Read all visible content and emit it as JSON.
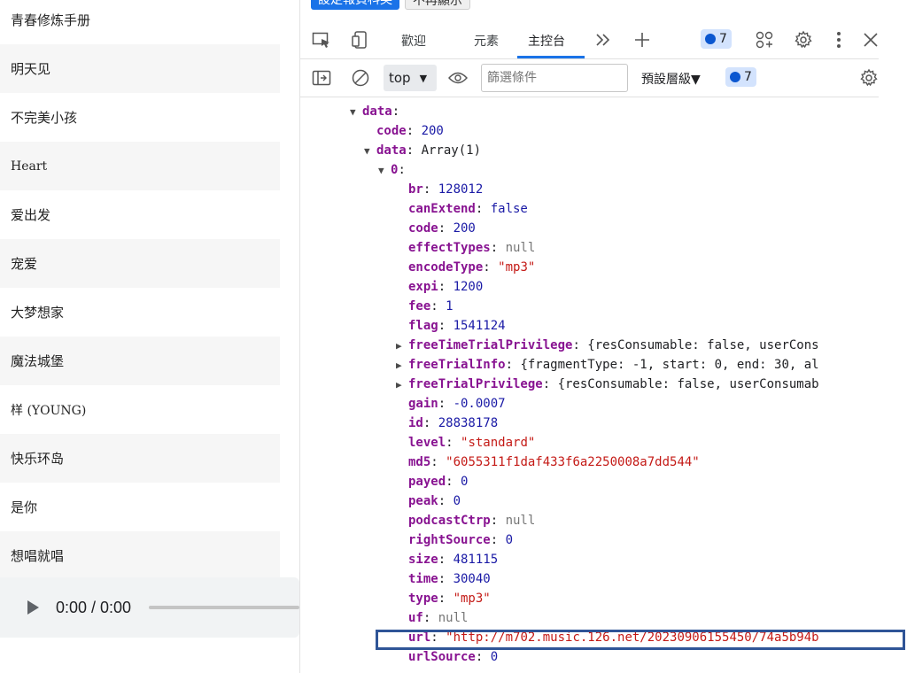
{
  "songs": [
    "青春修炼手册",
    "明天见",
    "不完美小孩",
    "Heart",
    "爱出发",
    "宠爱",
    "大梦想家",
    "魔法城堡",
    "样 (YOUNG)",
    "快乐环岛",
    "是你",
    "想唱就唱"
  ],
  "player": {
    "time": "0:00 / 0:00",
    "progress": 0
  },
  "page_buttons": {
    "primary": "設定報頁科英",
    "secondary": "不再顯示"
  },
  "devtools": {
    "tabs": {
      "welcome": "歡迎",
      "elements": "元素",
      "console": "主控台"
    },
    "issues_count": "7",
    "context": "top",
    "filter_placeholder": "篩選條件",
    "levels": "預設層級",
    "levels_caret": "▼",
    "message_count": "7"
  },
  "tree": [
    {
      "indent": 0,
      "tri": "down",
      "key": "data",
      "sep": ":",
      "val": "",
      "vt": "p"
    },
    {
      "indent": 1,
      "tri": "",
      "key": "code",
      "sep": ": ",
      "val": "200",
      "vt": "n"
    },
    {
      "indent": 1,
      "tri": "down",
      "key": "data",
      "sep": ": ",
      "val": "Array(1)",
      "vt": "p"
    },
    {
      "indent": 2,
      "tri": "down",
      "key": "0",
      "sep": ":",
      "val": "",
      "vt": "p"
    },
    {
      "indent": 3,
      "tri": "",
      "key": "br",
      "sep": ": ",
      "val": "128012",
      "vt": "n"
    },
    {
      "indent": 3,
      "tri": "",
      "key": "canExtend",
      "sep": ": ",
      "val": "false",
      "vt": "n"
    },
    {
      "indent": 3,
      "tri": "",
      "key": "code",
      "sep": ": ",
      "val": "200",
      "vt": "n"
    },
    {
      "indent": 3,
      "tri": "",
      "key": "effectTypes",
      "sep": ": ",
      "val": "null",
      "vt": "nl"
    },
    {
      "indent": 3,
      "tri": "",
      "key": "encodeType",
      "sep": ": ",
      "val": "\"mp3\"",
      "vt": "s"
    },
    {
      "indent": 3,
      "tri": "",
      "key": "expi",
      "sep": ": ",
      "val": "1200",
      "vt": "n"
    },
    {
      "indent": 3,
      "tri": "",
      "key": "fee",
      "sep": ": ",
      "val": "1",
      "vt": "n"
    },
    {
      "indent": 3,
      "tri": "",
      "key": "flag",
      "sep": ": ",
      "val": "1541124",
      "vt": "n"
    },
    {
      "indent": 3,
      "tri": "right",
      "key": "freeTimeTrialPrivilege",
      "sep": ": ",
      "val": "{resConsumable: false, userCons",
      "vt": "p"
    },
    {
      "indent": 3,
      "tri": "right",
      "key": "freeTrialInfo",
      "sep": ": ",
      "val": "{fragmentType: -1, start: 0, end: 30, al",
      "vt": "p"
    },
    {
      "indent": 3,
      "tri": "right",
      "key": "freeTrialPrivilege",
      "sep": ": ",
      "val": "{resConsumable: false, userConsumab",
      "vt": "p"
    },
    {
      "indent": 3,
      "tri": "",
      "key": "gain",
      "sep": ": ",
      "val": "-0.0007",
      "vt": "n"
    },
    {
      "indent": 3,
      "tri": "",
      "key": "id",
      "sep": ": ",
      "val": "28838178",
      "vt": "n"
    },
    {
      "indent": 3,
      "tri": "",
      "key": "level",
      "sep": ": ",
      "val": "\"standard\"",
      "vt": "s"
    },
    {
      "indent": 3,
      "tri": "",
      "key": "md5",
      "sep": ": ",
      "val": "\"6055311f1daf433f6a2250008a7dd544\"",
      "vt": "s"
    },
    {
      "indent": 3,
      "tri": "",
      "key": "payed",
      "sep": ": ",
      "val": "0",
      "vt": "n"
    },
    {
      "indent": 3,
      "tri": "",
      "key": "peak",
      "sep": ": ",
      "val": "0",
      "vt": "n"
    },
    {
      "indent": 3,
      "tri": "",
      "key": "podcastCtrp",
      "sep": ": ",
      "val": "null",
      "vt": "nl"
    },
    {
      "indent": 3,
      "tri": "",
      "key": "rightSource",
      "sep": ": ",
      "val": "0",
      "vt": "n"
    },
    {
      "indent": 3,
      "tri": "",
      "key": "size",
      "sep": ": ",
      "val": "481115",
      "vt": "n"
    },
    {
      "indent": 3,
      "tri": "",
      "key": "time",
      "sep": ": ",
      "val": "30040",
      "vt": "n"
    },
    {
      "indent": 3,
      "tri": "",
      "key": "type",
      "sep": ": ",
      "val": "\"mp3\"",
      "vt": "s"
    },
    {
      "indent": 3,
      "tri": "",
      "key": "uf",
      "sep": ": ",
      "val": "null",
      "vt": "nl"
    },
    {
      "indent": 3,
      "tri": "",
      "key": "url",
      "sep": ": ",
      "val": "\"http://m702.music.126.net/20230906155450/74a5b94b",
      "vt": "s"
    },
    {
      "indent": 3,
      "tri": "",
      "key": "urlSource",
      "sep": ": ",
      "val": "0",
      "vt": "n"
    }
  ],
  "colors": {
    "accent": "#1a73e8",
    "key": "#881391",
    "number": "#1a1aa6",
    "string": "#c41a16",
    "highlight": "#2f5597"
  }
}
